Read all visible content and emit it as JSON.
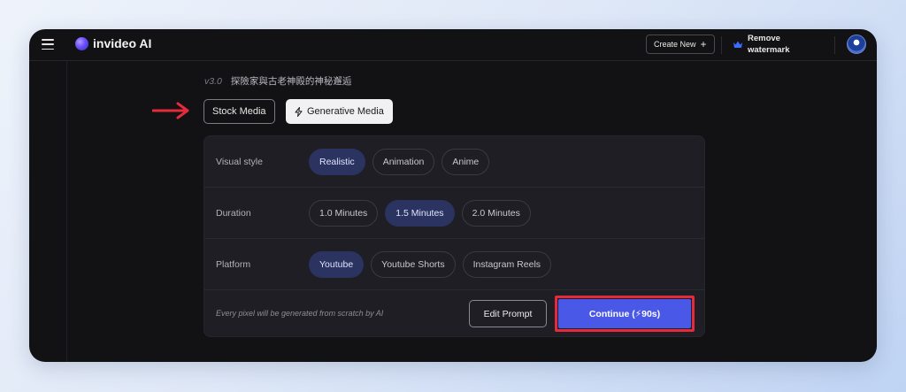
{
  "app": {
    "name": "invideo AI"
  },
  "header": {
    "create_new_label": "Create New",
    "remove_watermark_label": "Remove watermark"
  },
  "project": {
    "version": "v3.0",
    "title": "探險家與古老神殿的神秘邂逅"
  },
  "media_tabs": [
    {
      "label": "Stock Media",
      "selected": false
    },
    {
      "label": "Generative Media",
      "selected": true
    }
  ],
  "options": {
    "visual_style": {
      "label": "Visual style",
      "choices": [
        "Realistic",
        "Animation",
        "Anime"
      ],
      "selected": "Realistic"
    },
    "duration": {
      "label": "Duration",
      "choices": [
        "1.0 Minutes",
        "1.5 Minutes",
        "2.0 Minutes"
      ],
      "selected": "1.5 Minutes"
    },
    "platform": {
      "label": "Platform",
      "choices": [
        "Youtube",
        "Youtube Shorts",
        "Instagram Reels"
      ],
      "selected": "Youtube"
    }
  },
  "footer": {
    "note": "Every pixel will be generated from scratch by AI",
    "edit_prompt_label": "Edit Prompt",
    "continue_label": "Continue (⚡90s)"
  },
  "colors": {
    "accent_blue": "#4a58e8",
    "selected_chip": "#2b3360",
    "highlight_red": "#e52a3b"
  }
}
